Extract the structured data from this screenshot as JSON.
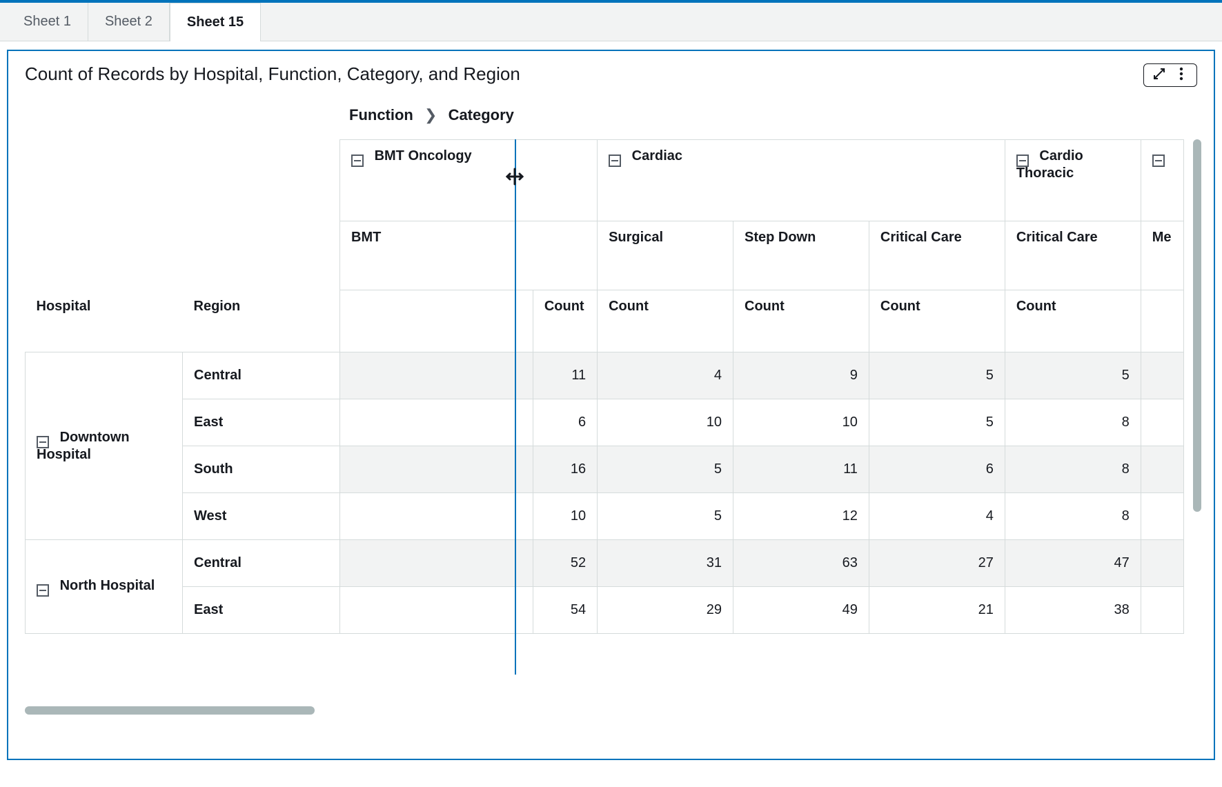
{
  "tabs": [
    "Sheet 1",
    "Sheet 2",
    "Sheet 15"
  ],
  "active_tab": 2,
  "panel": {
    "title": "Count of Records by Hospital, Function, Category, and Region"
  },
  "breadcrumb": {
    "a": "Function",
    "b": "Category"
  },
  "row_axis": {
    "a": "Hospital",
    "b": "Region"
  },
  "col_functions": [
    {
      "label": "BMT Oncology",
      "categories": [
        "BMT"
      ]
    },
    {
      "label": "Cardiac",
      "categories": [
        "Surgical",
        "Step Down",
        "Critical Care"
      ]
    },
    {
      "label": "Cardio Thoracic",
      "categories": [
        "Critical Care",
        "Me"
      ]
    }
  ],
  "metric_label": "Count",
  "rows": [
    {
      "hospital": "Downtown Hospital",
      "regions": [
        {
          "region": "Central",
          "values": [
            11,
            4,
            9,
            5,
            5
          ]
        },
        {
          "region": "East",
          "values": [
            6,
            10,
            10,
            5,
            8
          ]
        },
        {
          "region": "South",
          "values": [
            16,
            5,
            11,
            6,
            8
          ]
        },
        {
          "region": "West",
          "values": [
            10,
            5,
            12,
            4,
            8
          ]
        }
      ]
    },
    {
      "hospital": "North Hospital",
      "regions": [
        {
          "region": "Central",
          "values": [
            52,
            31,
            63,
            27,
            47
          ]
        },
        {
          "region": "East",
          "values": [
            54,
            29,
            49,
            21,
            38
          ]
        }
      ]
    }
  ]
}
